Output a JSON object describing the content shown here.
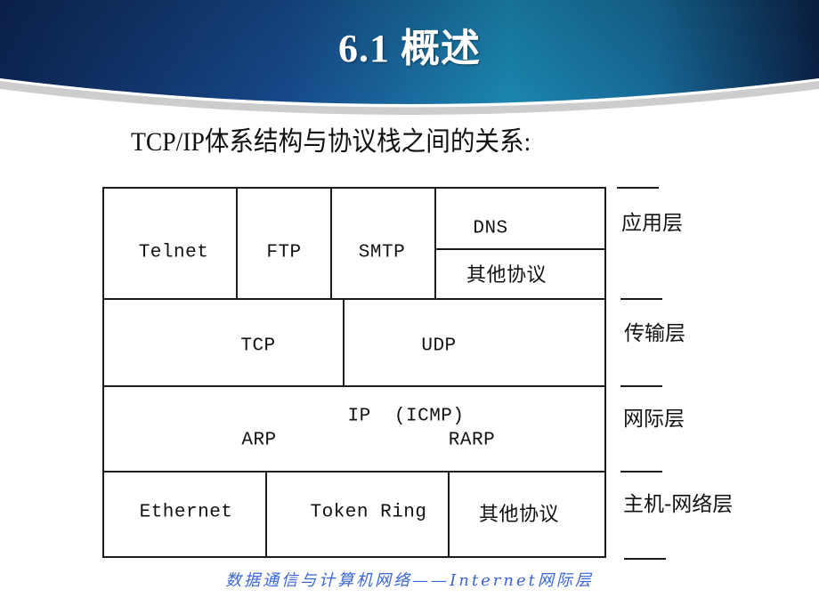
{
  "slide": {
    "title": "6.1  概述",
    "subtitle": "TCP/IP体系结构与协议栈之间的关系:",
    "footer": "数据通信与计算机网络——Internet网际层"
  },
  "colors": {
    "banner_dark": "#0d2a5c",
    "banner_mid": "#1b5a94",
    "banner_teal": "#1a8fb3",
    "line": "#1c1c1c",
    "footer_text": "#3a66d6"
  },
  "stack": {
    "application_row": {
      "telnet": "Telnet",
      "ftp": "FTP",
      "smtp": "SMTP",
      "dns": "DNS",
      "other": "其他协议"
    },
    "transport_row": {
      "tcp": "TCP",
      "udp": "UDP"
    },
    "internet_row": {
      "ip": "IP  (ICMP)",
      "arp": "ARP",
      "rarp": "RARP"
    },
    "link_row": {
      "ethernet": "Ethernet",
      "token_ring": "Token Ring",
      "other": "其他协议"
    }
  },
  "layers": [
    {
      "label": "应用层"
    },
    {
      "label": "传输层"
    },
    {
      "label": "网际层"
    },
    {
      "label": "主机-网络层"
    }
  ]
}
